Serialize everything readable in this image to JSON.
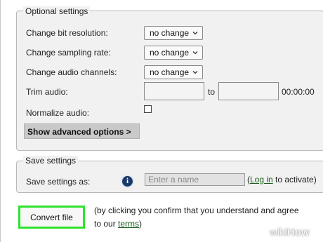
{
  "optional_settings": {
    "legend": "Optional settings",
    "bit_resolution": {
      "label": "Change bit resolution:",
      "value": "no change"
    },
    "sampling_rate": {
      "label": "Change sampling rate:",
      "value": "no change"
    },
    "audio_channels": {
      "label": "Change audio channels:",
      "value": "no change"
    },
    "trim": {
      "label": "Trim audio:",
      "to_label": "to",
      "end_time": "00:00:00"
    },
    "normalize": {
      "label": "Normalize audio:"
    },
    "advanced_button": "Show advanced options >"
  },
  "save_settings": {
    "legend": "Save settings",
    "label": "Save settings as:",
    "info_icon_glyph": "i",
    "name_placeholder": "Enter a name",
    "paren_open": "(",
    "login_link": "Log in",
    "login_suffix": " to activate)"
  },
  "convert": {
    "button_label": "Convert file",
    "note_line1": "(by clicking you confirm that you understand and agree",
    "note_line2_prefix": "to our ",
    "terms_link": "terms",
    "note_line2_suffix": ")"
  },
  "watermark": {
    "wiki": "wiki",
    "how": "How"
  },
  "colors": {
    "panel_bg": "#f1f1f1",
    "convert_border": "#2ee32e",
    "link": "#1a5c1a",
    "info_icon": "#1a3a6b"
  }
}
